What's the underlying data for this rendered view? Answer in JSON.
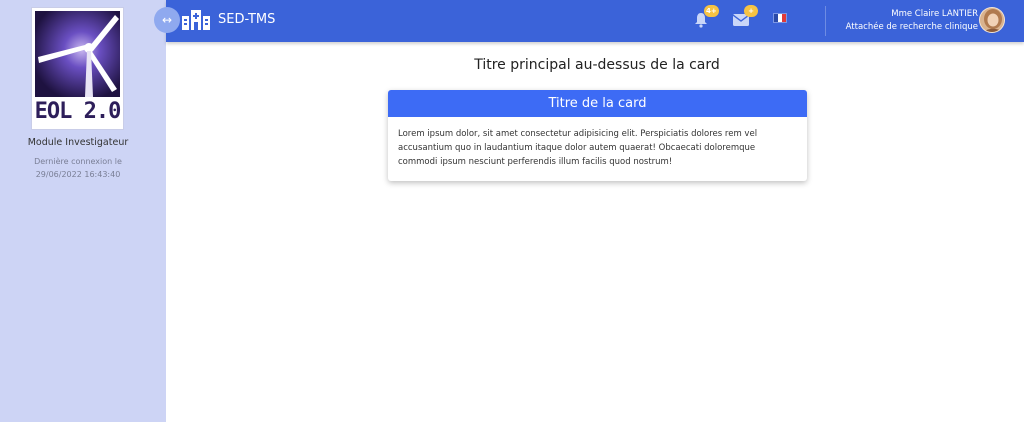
{
  "sidebar": {
    "logo_text": "EOL 2.0",
    "module_label": "Module Investigateur",
    "last_connection_label": "Dernière connexion le",
    "last_connection_value": "29/06/2022 16:43:40"
  },
  "topbar": {
    "app_title": "SED-TMS",
    "toggle_icon": "expand-arrows-icon",
    "notifications": {
      "icon": "bell-icon",
      "badge": "4+"
    },
    "messages": {
      "icon": "envelope-icon",
      "badge": "+"
    },
    "language_flag": "fr-flag-icon",
    "user": {
      "name": "Mme Claire LANTIER",
      "role": "Attachée de recherche clinique"
    }
  },
  "main": {
    "page_title": "Titre principal au-dessus de la card",
    "card": {
      "title": "Titre de la card",
      "body": "Lorem ipsum dolor, sit amet consectetur adipisicing elit. Perspiciatis dolores rem vel accusantium quo in laudantium itaque dolor autem quaerat! Obcaecati doloremque commodi ipsum nesciunt perferendis illum facilis quod nostrum!"
    }
  },
  "colors": {
    "topbar": "#3b63d9",
    "sidebar": "#cdd4f5",
    "card_header": "#3d6bf5",
    "badge": "#f6c344"
  }
}
